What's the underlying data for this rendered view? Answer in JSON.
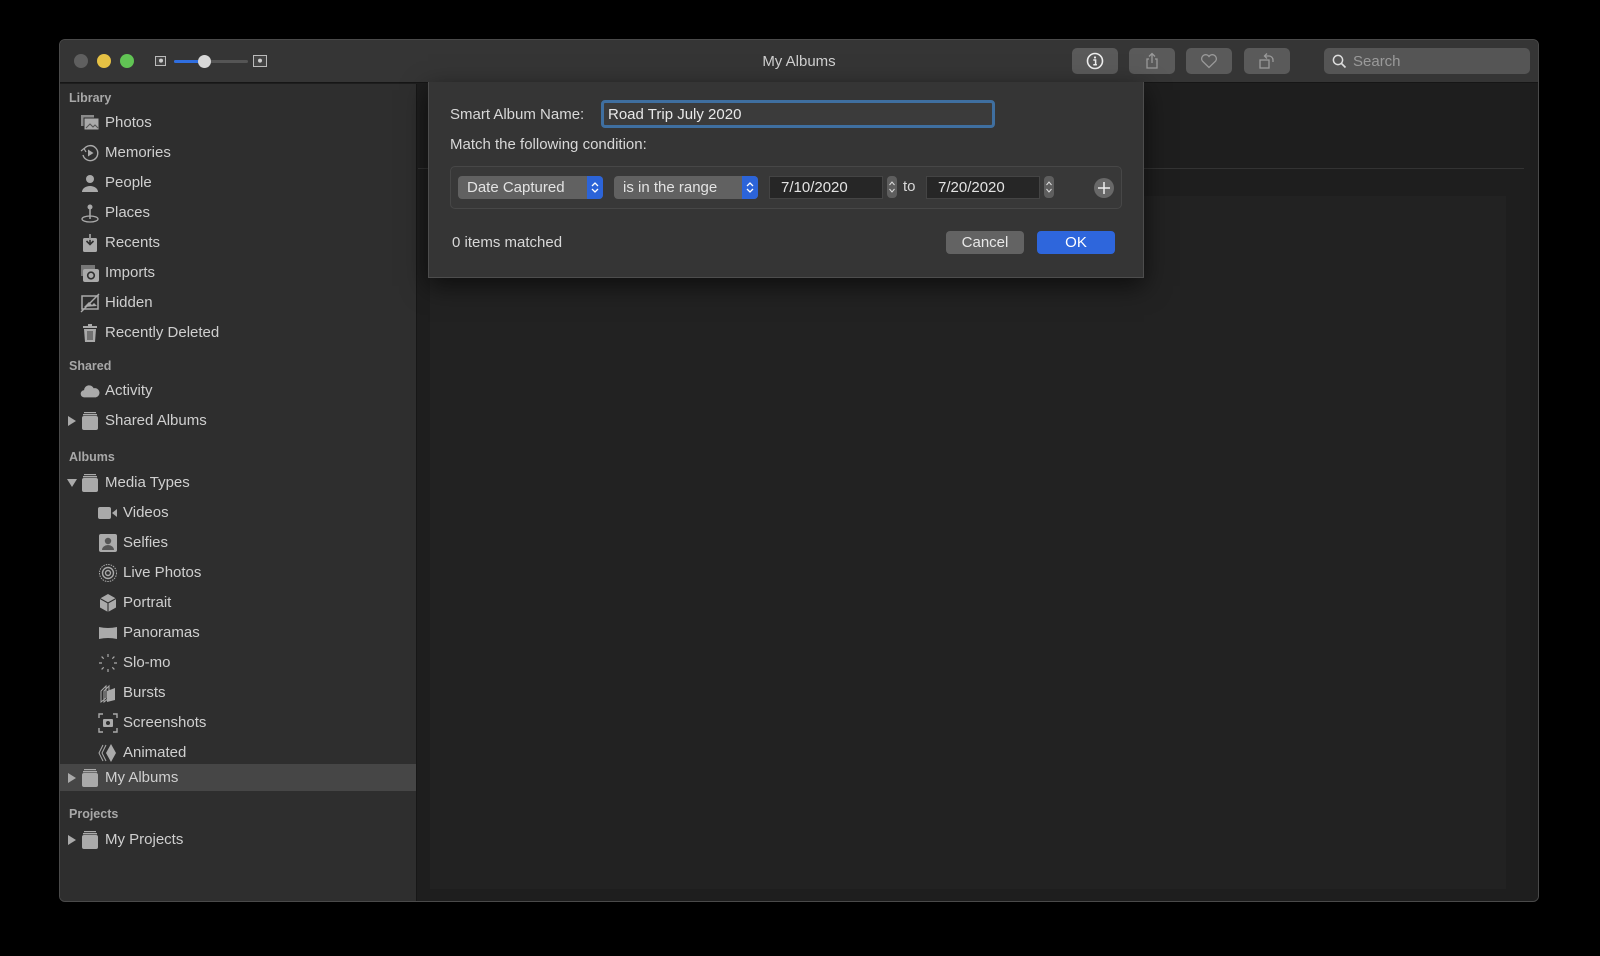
{
  "window": {
    "title": "My Albums",
    "zoom_slider_value": 0.4
  },
  "toolbar": {
    "buttons": [
      {
        "name": "info-button",
        "icon": "info-icon"
      },
      {
        "name": "share-button",
        "icon": "share-icon"
      },
      {
        "name": "favorite-button",
        "icon": "heart-icon"
      },
      {
        "name": "rotate-button",
        "icon": "rotate-icon"
      }
    ],
    "search_placeholder": "Search",
    "search_value": ""
  },
  "sidebar": {
    "sections": {
      "library": "Library",
      "shared": "Shared",
      "albums": "Albums",
      "projects": "Projects"
    },
    "library_items": [
      {
        "label": "Photos",
        "icon": "photos-icon"
      },
      {
        "label": "Memories",
        "icon": "memories-icon"
      },
      {
        "label": "People",
        "icon": "person-icon"
      },
      {
        "label": "Places",
        "icon": "pin-icon"
      },
      {
        "label": "Recents",
        "icon": "recents-icon"
      },
      {
        "label": "Imports",
        "icon": "camera-icon"
      },
      {
        "label": "Hidden",
        "icon": "hidden-icon"
      },
      {
        "label": "Recently Deleted",
        "icon": "trash-icon"
      }
    ],
    "shared_items": [
      {
        "label": "Activity",
        "icon": "cloud-icon"
      },
      {
        "label": "Shared Albums",
        "icon": "album-stack-icon",
        "disclosure": "collapsed"
      }
    ],
    "albums_items": [
      {
        "label": "Media Types",
        "icon": "album-stack-icon",
        "disclosure": "expanded"
      },
      {
        "label": "Videos",
        "icon": "video-icon"
      },
      {
        "label": "Selfies",
        "icon": "selfie-icon"
      },
      {
        "label": "Live Photos",
        "icon": "live-photo-icon"
      },
      {
        "label": "Portrait",
        "icon": "cube-icon"
      },
      {
        "label": "Panoramas",
        "icon": "panorama-icon"
      },
      {
        "label": "Slo-mo",
        "icon": "slomo-icon"
      },
      {
        "label": "Bursts",
        "icon": "bursts-icon"
      },
      {
        "label": "Screenshots",
        "icon": "screenshot-icon"
      },
      {
        "label": "Animated",
        "icon": "animated-icon"
      },
      {
        "label": "My Albums",
        "icon": "album-stack-icon",
        "disclosure": "collapsed",
        "selected": true
      }
    ],
    "projects_items": [
      {
        "label": "My Projects",
        "icon": "album-stack-icon",
        "disclosure": "collapsed"
      }
    ]
  },
  "dialog": {
    "name_label": "Smart Album Name:",
    "name_value": "Road Trip July 2020",
    "match_label": "Match the following condition:",
    "condition": {
      "field": "Date Captured",
      "operator": "is in the range",
      "from_date": "7/10/2020",
      "to_label": "to",
      "to_date": "7/20/2020"
    },
    "matched_text": "0 items matched",
    "cancel_label": "Cancel",
    "ok_label": "OK"
  },
  "colors": {
    "accent": "#2e66dc",
    "focus_ring": "#3f6fa0",
    "selection": "#464646"
  }
}
